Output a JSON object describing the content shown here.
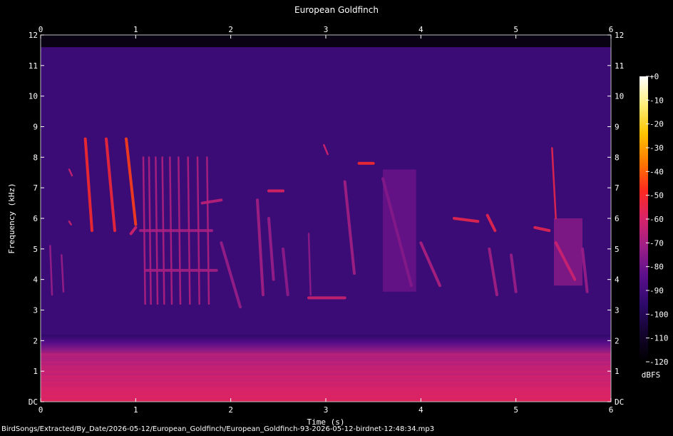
{
  "chart_data": {
    "type": "heatmap",
    "title": "European Goldfinch",
    "xlabel": "Time (s)",
    "ylabel": "Frequency (kHz)",
    "x_ticks": [
      "0",
      "1",
      "2",
      "3",
      "4",
      "5",
      "6"
    ],
    "xlim": [
      0,
      6
    ],
    "y_ticks": [
      "DC",
      "1",
      "2",
      "3",
      "4",
      "5",
      "6",
      "7",
      "8",
      "9",
      "10",
      "11",
      "12"
    ],
    "ylim": [
      0,
      12
    ],
    "colorbar": {
      "label": "dBFS",
      "ticks": [
        "+0",
        "-10",
        "-20",
        "-30",
        "-40",
        "-50",
        "-60",
        "-70",
        "-80",
        "-90",
        "-100",
        "-110",
        "-120"
      ],
      "range": [
        -120,
        0
      ],
      "colors": [
        "#000000",
        "#14042e",
        "#2d0a6b",
        "#5a0f8c",
        "#9b1e88",
        "#d6236a",
        "#ff2a20",
        "#ff7a00",
        "#ffc400",
        "#fff07a",
        "#ffffff"
      ]
    },
    "background_level_db": -92,
    "low_band": {
      "freq_khz": [
        0,
        1.6
      ],
      "level_db": -58
    },
    "calls": [
      {
        "t": [
          0.47,
          0.54
        ],
        "f": [
          8.6,
          5.6
        ],
        "db": -50
      },
      {
        "t": [
          0.69,
          0.78
        ],
        "f": [
          8.6,
          5.6
        ],
        "db": -52
      },
      {
        "t": [
          0.9,
          1.0
        ],
        "f": [
          8.6,
          5.8
        ],
        "db": -45
      },
      {
        "t": [
          0.95,
          1.0
        ],
        "f": [
          5.5,
          5.7
        ],
        "db": -60
      },
      {
        "t": [
          1.05,
          1.8
        ],
        "f": [
          5.6,
          5.6
        ],
        "db": -70
      },
      {
        "t": [
          1.08,
          1.1
        ],
        "f": [
          8.0,
          3.2
        ],
        "db": -68
      },
      {
        "t": [
          1.14,
          1.16
        ],
        "f": [
          8.0,
          3.2
        ],
        "db": -68
      },
      {
        "t": [
          1.21,
          1.23
        ],
        "f": [
          8.0,
          3.2
        ],
        "db": -68
      },
      {
        "t": [
          1.28,
          1.3
        ],
        "f": [
          8.0,
          3.2
        ],
        "db": -68
      },
      {
        "t": [
          1.36,
          1.38
        ],
        "f": [
          8.0,
          3.2
        ],
        "db": -68
      },
      {
        "t": [
          1.45,
          1.47
        ],
        "f": [
          8.0,
          3.2
        ],
        "db": -68
      },
      {
        "t": [
          1.55,
          1.57
        ],
        "f": [
          8.0,
          3.2
        ],
        "db": -68
      },
      {
        "t": [
          1.65,
          1.67
        ],
        "f": [
          8.0,
          3.2
        ],
        "db": -68
      },
      {
        "t": [
          1.75,
          1.77
        ],
        "f": [
          8.0,
          3.2
        ],
        "db": -68
      },
      {
        "t": [
          1.1,
          1.85
        ],
        "f": [
          4.3,
          4.3
        ],
        "db": -70
      },
      {
        "t": [
          1.7,
          1.9
        ],
        "f": [
          6.5,
          6.6
        ],
        "db": -65
      },
      {
        "t": [
          1.9,
          2.1
        ],
        "f": [
          5.2,
          3.1
        ],
        "db": -72
      },
      {
        "t": [
          2.28,
          2.34
        ],
        "f": [
          6.6,
          3.5
        ],
        "db": -70
      },
      {
        "t": [
          2.4,
          2.55
        ],
        "f": [
          6.9,
          6.9
        ],
        "db": -58
      },
      {
        "t": [
          2.4,
          2.45
        ],
        "f": [
          6.0,
          4.0
        ],
        "db": -72
      },
      {
        "t": [
          2.55,
          2.6
        ],
        "f": [
          5.0,
          3.5
        ],
        "db": -74
      },
      {
        "t": [
          2.82,
          2.84
        ],
        "f": [
          5.5,
          3.5
        ],
        "db": -74
      },
      {
        "t": [
          2.98,
          3.02
        ],
        "f": [
          8.4,
          8.1
        ],
        "db": -60
      },
      {
        "t": [
          2.82,
          3.2
        ],
        "f": [
          3.4,
          3.4
        ],
        "db": -62
      },
      {
        "t": [
          3.2,
          3.3
        ],
        "f": [
          7.2,
          4.2
        ],
        "db": -70
      },
      {
        "t": [
          3.35,
          3.5
        ],
        "f": [
          7.8,
          7.8
        ],
        "db": -50
      },
      {
        "t": [
          3.6,
          3.9
        ],
        "f": [
          7.3,
          3.8
        ],
        "db": -76
      },
      {
        "t": [
          4.0,
          4.2
        ],
        "f": [
          5.2,
          3.8
        ],
        "db": -68
      },
      {
        "t": [
          4.35,
          4.6
        ],
        "f": [
          6.0,
          5.9
        ],
        "db": -55
      },
      {
        "t": [
          4.7,
          4.78
        ],
        "f": [
          6.1,
          5.6
        ],
        "db": -55
      },
      {
        "t": [
          4.72,
          4.8
        ],
        "f": [
          5.0,
          3.5
        ],
        "db": -70
      },
      {
        "t": [
          4.95,
          5.0
        ],
        "f": [
          4.8,
          3.6
        ],
        "db": -72
      },
      {
        "t": [
          5.2,
          5.35
        ],
        "f": [
          5.7,
          5.6
        ],
        "db": -56
      },
      {
        "t": [
          5.38,
          5.42
        ],
        "f": [
          8.3,
          6.0
        ],
        "db": -55
      },
      {
        "t": [
          5.42,
          5.62
        ],
        "f": [
          5.2,
          4.0
        ],
        "db": -62
      },
      {
        "t": [
          5.7,
          5.75
        ],
        "f": [
          5.0,
          3.6
        ],
        "db": -72
      },
      {
        "t": [
          0.3,
          0.33
        ],
        "f": [
          7.6,
          7.4
        ],
        "db": -62
      },
      {
        "t": [
          0.3,
          0.32
        ],
        "f": [
          5.9,
          5.8
        ],
        "db": -62
      },
      {
        "t": [
          0.1,
          0.12
        ],
        "f": [
          5.1,
          3.5
        ],
        "db": -72
      },
      {
        "t": [
          0.22,
          0.24
        ],
        "f": [
          4.8,
          3.6
        ],
        "db": -72
      }
    ],
    "noise_patches": [
      {
        "t": [
          3.6,
          3.95
        ],
        "f": [
          3.6,
          7.6
        ],
        "db": -80
      },
      {
        "t": [
          5.4,
          5.7
        ],
        "f": [
          3.8,
          6.0
        ],
        "db": -74
      }
    ]
  },
  "footer_path": "BirdSongs/Extracted/By_Date/2026-05-12/European_Goldfinch/European_Goldfinch-93-2026-05-12-birdnet-12:48:34.mp3"
}
